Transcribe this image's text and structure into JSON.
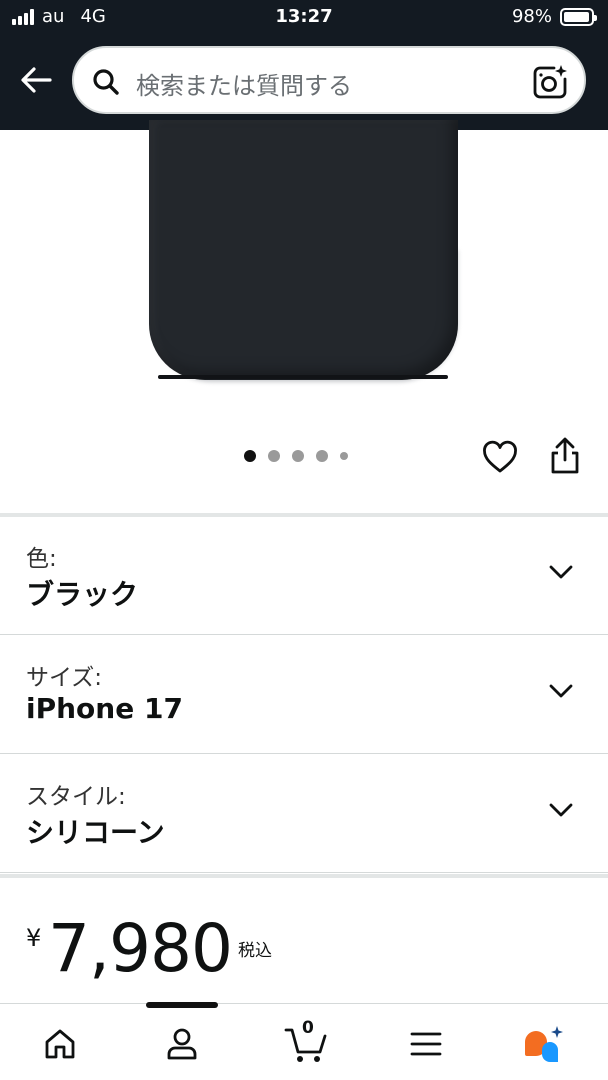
{
  "status_bar": {
    "carrier": "au",
    "network": "4G",
    "time": "13:27",
    "battery_percent": "98%",
    "battery_level": 0.98,
    "signal_bars": 4
  },
  "header": {
    "back_icon": "arrow-left-icon",
    "search": {
      "placeholder": "検索または質問する",
      "icon": "search-icon",
      "camera_icon": "camera-lens-icon"
    }
  },
  "product_gallery": {
    "image_alt": "iPhone silicone case (black)",
    "page_count": 5,
    "active_index": 0,
    "heart_icon": "heart-outline-icon",
    "share_icon": "share-icon"
  },
  "variations": [
    {
      "label": "色:",
      "value": "ブラック"
    },
    {
      "label": "サイズ:",
      "value": "iPhone 17"
    },
    {
      "label": "スタイル:",
      "value": "シリコーン"
    }
  ],
  "price": {
    "symbol": "¥",
    "amount": "7,980",
    "tax_note": "税込"
  },
  "bottom_nav": {
    "items": [
      {
        "name": "home",
        "icon": "home-icon"
      },
      {
        "name": "account",
        "icon": "person-icon"
      },
      {
        "name": "cart",
        "icon": "cart-icon",
        "count": "0"
      },
      {
        "name": "menu",
        "icon": "menu-icon"
      },
      {
        "name": "rufus",
        "icon": "ai-assistant-icon"
      }
    ],
    "active_index": 1
  },
  "colors": {
    "header_bg": "#131a22",
    "case_color": "#23272c",
    "assistant_orange": "#f36d21",
    "assistant_blue": "#1a98ff"
  }
}
